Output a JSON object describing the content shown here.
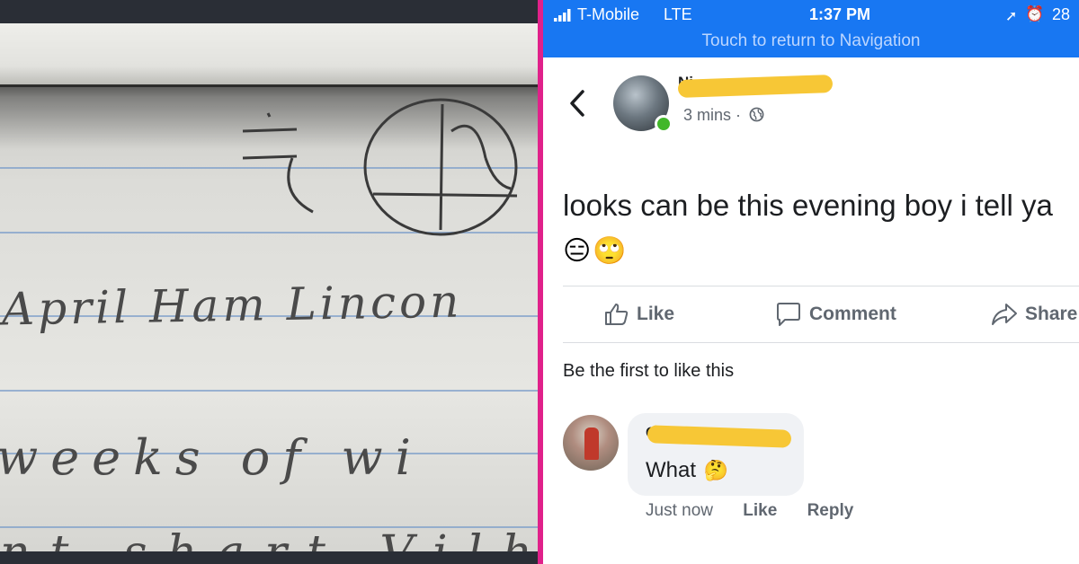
{
  "left_photo": {
    "handwriting": {
      "line1": "April Ham Lincon",
      "line2": "weeks of wi",
      "line3": "nt shart Vilh"
    }
  },
  "status_bar": {
    "carrier": "T-Mobile",
    "network": "LTE",
    "time": "1:37 PM",
    "battery": "28",
    "navigation_hint": "Touch to return to Navigation"
  },
  "post": {
    "author_name": "Ni",
    "timestamp": "3 mins ·",
    "text": "looks can be this evening boy i tell ya",
    "emojis": "😑🙄",
    "actions": {
      "like": "Like",
      "comment": "Comment",
      "share": "Share"
    },
    "likes_summary": "Be the first to like this"
  },
  "comment": {
    "author_stub": "Ca",
    "text": "What",
    "emoji": "🤔",
    "time": "Just now",
    "like": "Like",
    "reply": "Reply"
  },
  "colors": {
    "facebook_blue": "#1877f2",
    "divider": "#e0218a",
    "redaction": "#f7c736",
    "online": "#42b72a"
  },
  "icons": [
    "signal-icon",
    "location-icon",
    "alarm-icon",
    "back-icon",
    "globe-icon",
    "like-icon",
    "comment-icon",
    "share-icon"
  ]
}
